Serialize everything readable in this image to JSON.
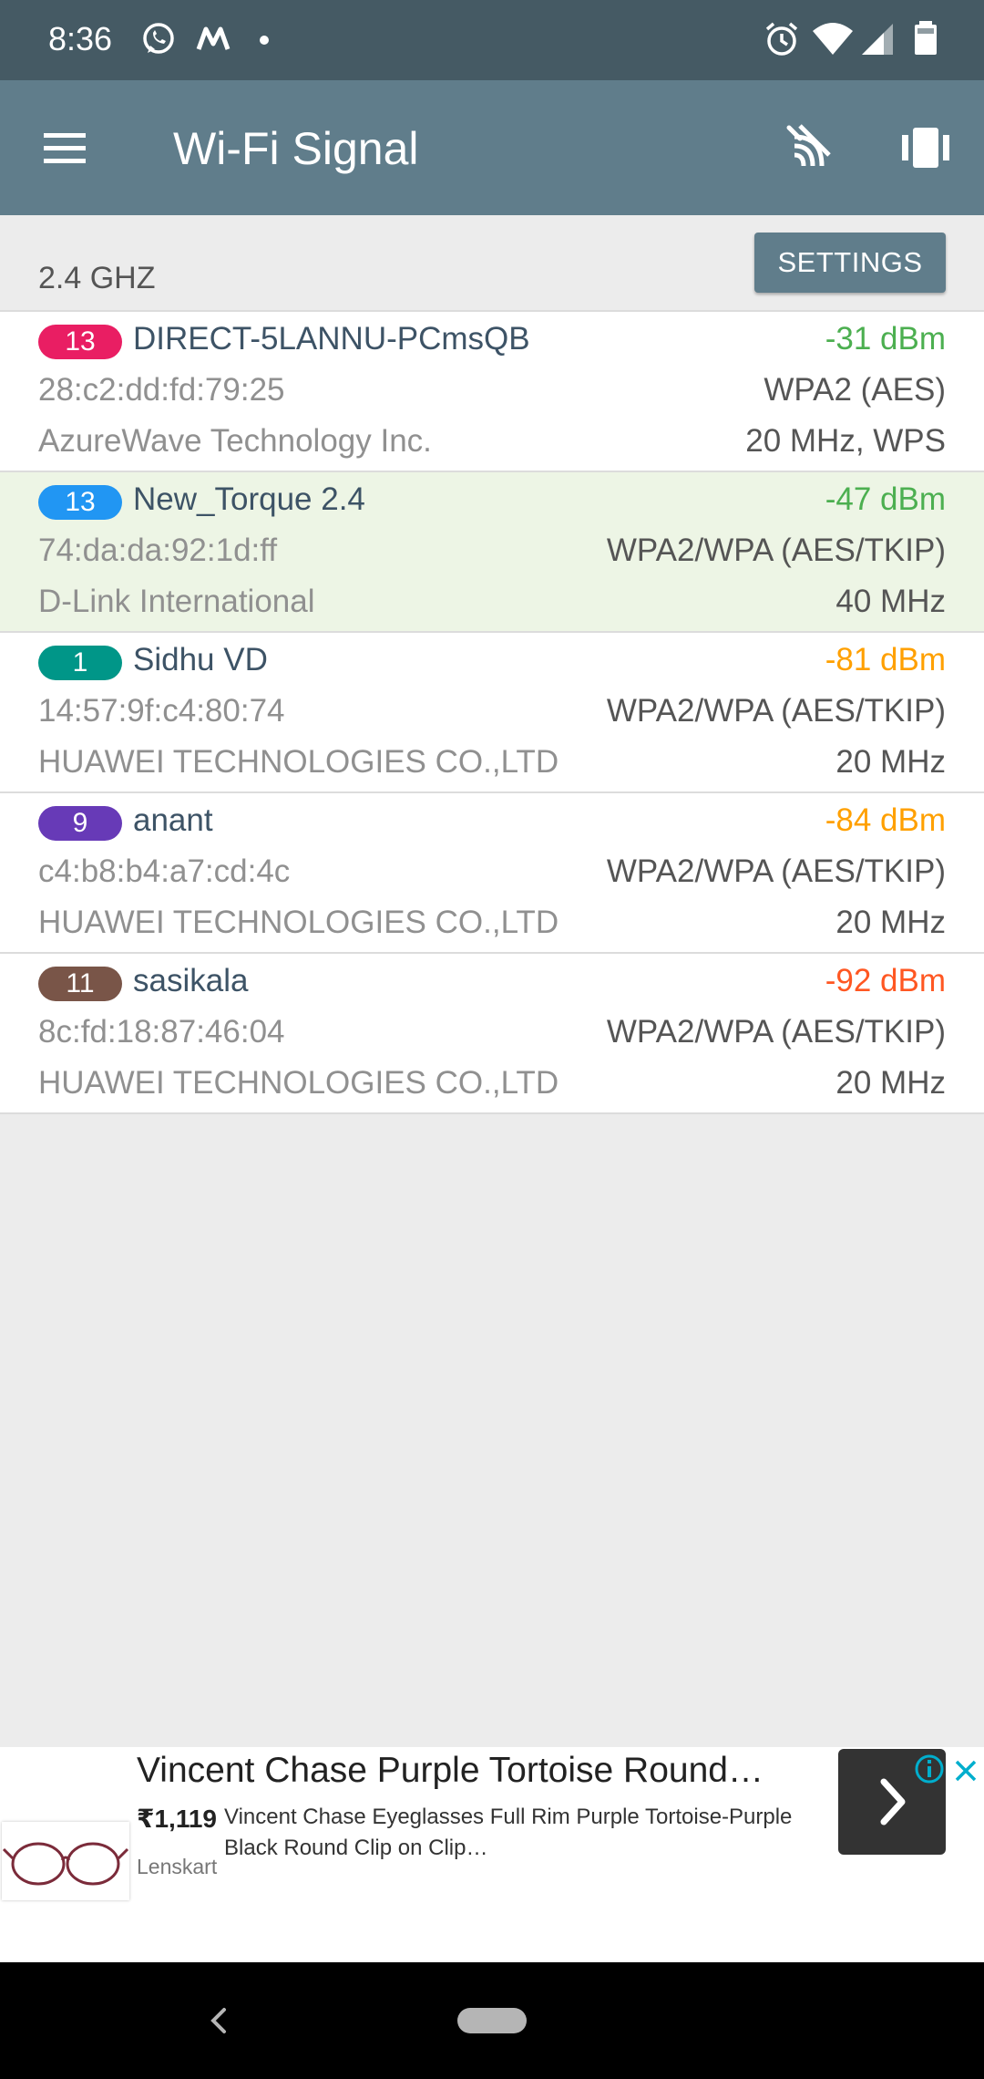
{
  "status_bar": {
    "time": "8:36",
    "left_icons": [
      "whatsapp-icon",
      "m-logo-icon",
      "dot-icon"
    ],
    "right_icons": [
      "alarm-icon",
      "wifi-icon",
      "cell-signal-icon",
      "battery-icon"
    ]
  },
  "toolbar": {
    "title": "Wi-Fi Signal",
    "actions": [
      "scan-icon",
      "vibrate-icon"
    ]
  },
  "band": {
    "label": "2.4 GHZ",
    "settings_label": "SETTINGS"
  },
  "networks": [
    {
      "channel": "13",
      "channel_color": "#e91e63",
      "ssid": "DIRECT-5LANNU-PCmsQB",
      "signal": "-31 dBm",
      "signal_color": "#4caf50",
      "mac": "28:c2:dd:fd:79:25",
      "security": "WPA2 (AES)",
      "vendor": "AzureWave Technology Inc.",
      "width": "20 MHz, WPS",
      "connected": false
    },
    {
      "channel": "13",
      "channel_color": "#2196f3",
      "ssid": "New_Torque 2.4",
      "signal": "-47 dBm",
      "signal_color": "#4caf50",
      "mac": "74:da:da:92:1d:ff",
      "security": "WPA2/WPA (AES/TKIP)",
      "vendor": "D-Link International",
      "width": "40 MHz",
      "connected": true
    },
    {
      "channel": "1",
      "channel_color": "#009688",
      "ssid": "Sidhu VD",
      "signal": "-81 dBm",
      "signal_color": "#ffa000",
      "mac": "14:57:9f:c4:80:74",
      "security": "WPA2/WPA (AES/TKIP)",
      "vendor": "HUAWEI TECHNOLOGIES CO.,LTD",
      "width": "20 MHz",
      "connected": false
    },
    {
      "channel": "9",
      "channel_color": "#673ab7",
      "ssid": "anant",
      "signal": "-84 dBm",
      "signal_color": "#ffa000",
      "mac": "c4:b8:b4:a7:cd:4c",
      "security": "WPA2/WPA (AES/TKIP)",
      "vendor": "HUAWEI TECHNOLOGIES CO.,LTD",
      "width": "20 MHz",
      "connected": false
    },
    {
      "channel": "11",
      "channel_color": "#795548",
      "ssid": "sasikala",
      "signal": "-92 dBm",
      "signal_color": "#ff5722",
      "mac": "8c:fd:18:87:46:04",
      "security": "WPA2/WPA (AES/TKIP)",
      "vendor": "HUAWEI TECHNOLOGIES CO.,LTD",
      "width": "20 MHz",
      "connected": false
    }
  ],
  "ad": {
    "title": "Vincent Chase Purple Tortoise Round…",
    "price": "₹1,119",
    "description": "Vincent Chase Eyeglasses Full Rim Purple Tortoise-Purple Black Round Clip on Clip…",
    "source": "Lenskart"
  },
  "colors": {
    "status_bar": "#455a64",
    "toolbar": "#607d8b",
    "connected_row": "#edf5e5"
  }
}
